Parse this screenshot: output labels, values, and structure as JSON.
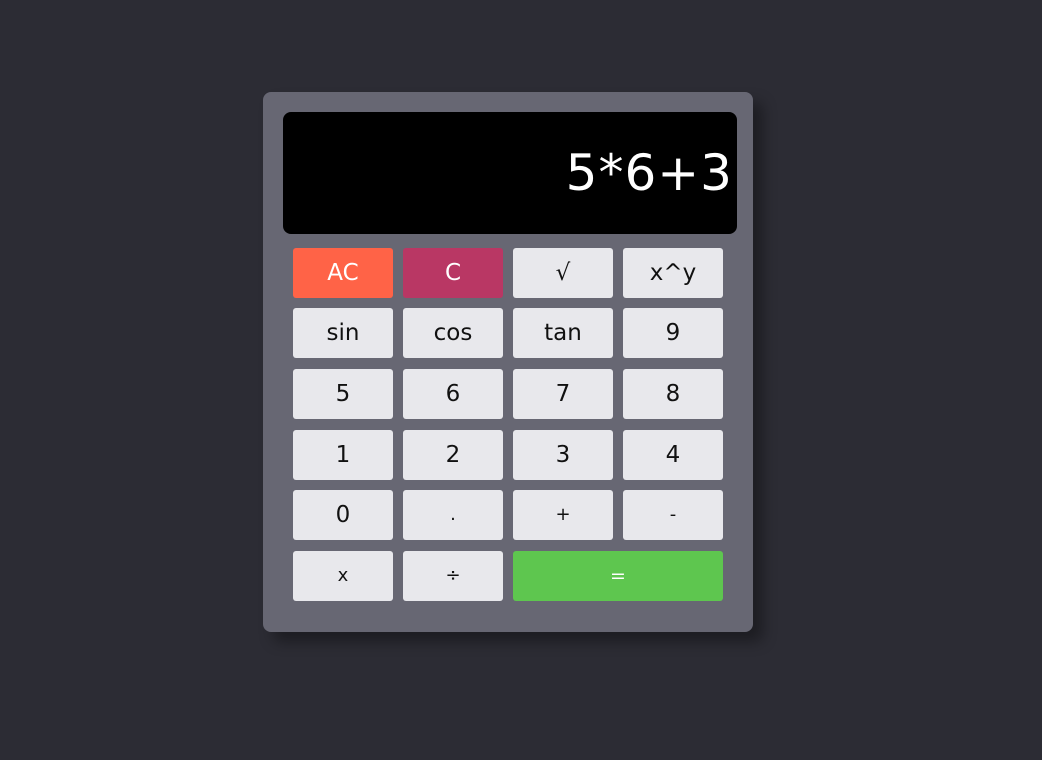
{
  "display": {
    "expression": "5*6+3"
  },
  "keys": {
    "ac": "AC",
    "c": "C",
    "sqrt": "√",
    "power": "x^y",
    "sin": "sin",
    "cos": "cos",
    "tan": "tan",
    "nine": "9",
    "five": "5",
    "six": "6",
    "seven": "7",
    "eight": "8",
    "one": "1",
    "two": "2",
    "three": "3",
    "four": "4",
    "zero": "0",
    "decimal": ".",
    "plus": "+",
    "minus": "-",
    "multiply": "x",
    "divide": "÷",
    "equals": "="
  },
  "colors": {
    "page_background": "#2c2c34",
    "calculator_body": "#676773",
    "display_background": "#000000",
    "key_background": "#e8e8ec",
    "all_clear": "#ff6347",
    "clear": "#b93764",
    "equals": "#5ec64f"
  }
}
